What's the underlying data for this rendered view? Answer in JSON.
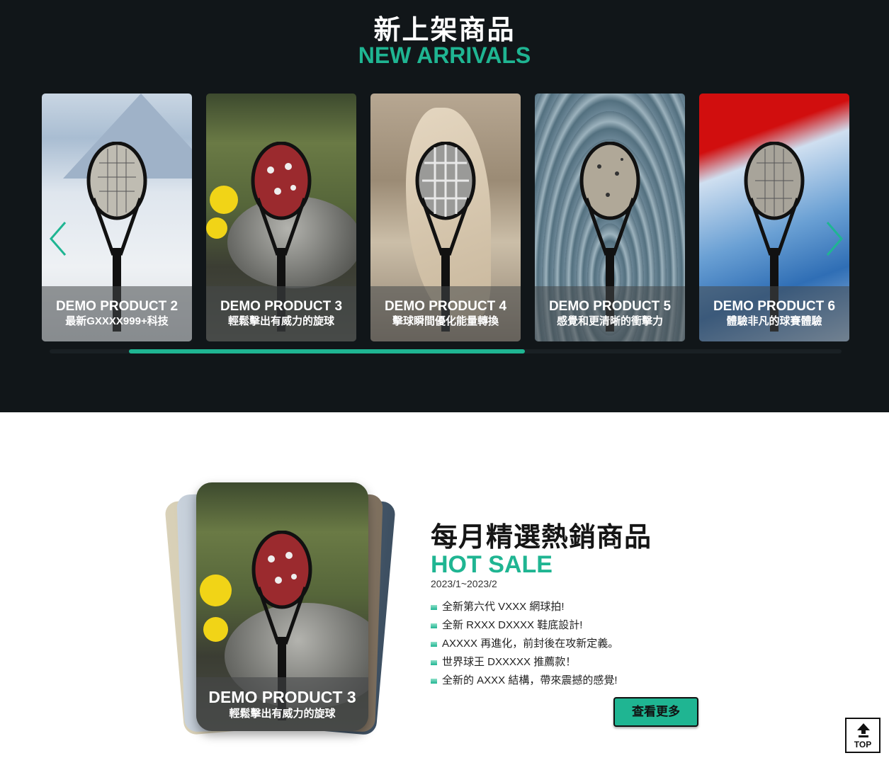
{
  "new_arrivals": {
    "title_zh": "新上架商品",
    "title_en": "NEW ARRIVALS",
    "products": [
      {
        "name": "DEMO PRODUCT 2",
        "desc": "最新GXXXX999+科技"
      },
      {
        "name": "DEMO PRODUCT 3",
        "desc": "輕鬆擊出有威力的旋球"
      },
      {
        "name": "DEMO PRODUCT 4",
        "desc": "擊球瞬間優化能量轉換"
      },
      {
        "name": "DEMO PRODUCT 5",
        "desc": "感覺和更清晰的衝擊力"
      },
      {
        "name": "DEMO PRODUCT 6",
        "desc": "體驗非凡的球賽體驗"
      }
    ],
    "prev_icon": "chevron-left-icon",
    "next_icon": "chevron-right-icon",
    "scroll_progress_start": 0.1,
    "scroll_progress_end": 0.6
  },
  "hot_sale": {
    "title_zh": "每月精選熱銷商品",
    "title_en": "HOT SALE",
    "date_range": "2023/1~2023/2",
    "featured": {
      "name": "DEMO PRODUCT 3",
      "desc": "輕鬆擊出有威力的旋球"
    },
    "items": [
      "全新第六代 VXXX 網球拍!",
      "全新 RXXX DXXXX 鞋底設計!",
      "AXXXX 再進化，前封後在攻新定義。",
      "世界球王 DXXXXX 推薦款！",
      "全新的 AXXX 結構，帶來震撼的感覺!"
    ],
    "more_label": "查看更多"
  },
  "top_button": {
    "label": "TOP",
    "icon": "arrow-up-icon"
  },
  "colors": {
    "accent": "#1fb592",
    "dark_bg": "#111619"
  }
}
